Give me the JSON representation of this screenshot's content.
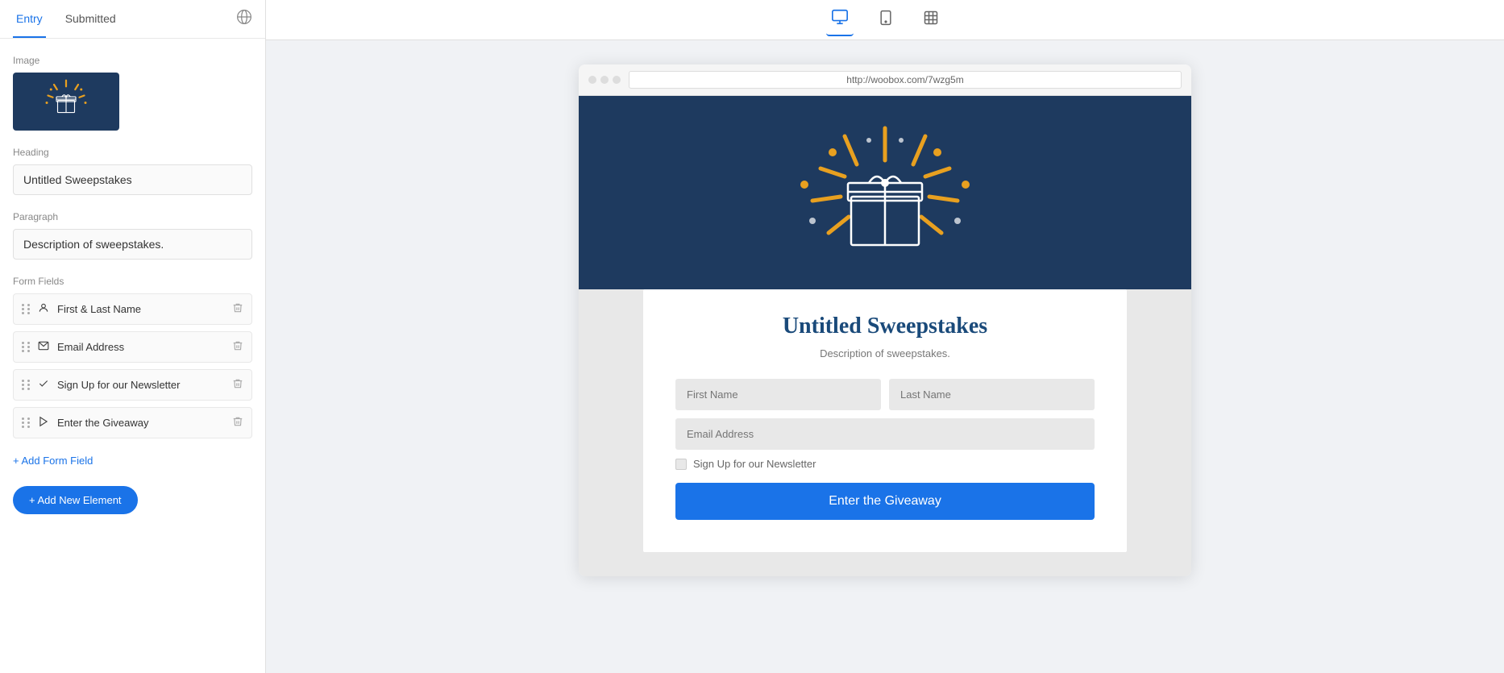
{
  "tabs": {
    "entry": "Entry",
    "submitted": "Submitted"
  },
  "left_panel": {
    "image_label": "Image",
    "heading_label": "Heading",
    "heading_value": "Untitled Sweepstakes",
    "paragraph_label": "Paragraph",
    "paragraph_value": "Description of sweepstakes.",
    "form_fields_label": "Form Fields",
    "fields": [
      {
        "icon": "👤",
        "label": "First & Last Name",
        "icon_name": "person-icon"
      },
      {
        "icon": "✉",
        "label": "Email Address",
        "icon_name": "email-icon"
      },
      {
        "icon": "✔",
        "label": "Sign Up for our Newsletter",
        "icon_name": "check-icon"
      },
      {
        "icon": "▶",
        "label": "Enter the Giveaway",
        "icon_name": "arrow-icon"
      }
    ],
    "add_field_label": "+ Add Form Field",
    "add_element_label": "+ Add New Element"
  },
  "preview": {
    "url": "http://woobox.com/7wzg5m",
    "title": "Untitled Sweepstakes",
    "description": "Description of sweepstakes.",
    "first_name_placeholder": "First Name",
    "last_name_placeholder": "Last Name",
    "email_placeholder": "Email Address",
    "newsletter_label": "Sign Up for our Newsletter",
    "submit_label": "Enter the Giveaway"
  },
  "toolbar": {
    "desktop_icon": "🖥",
    "tablet_icon": "📱",
    "frame_icon": "⬜"
  }
}
